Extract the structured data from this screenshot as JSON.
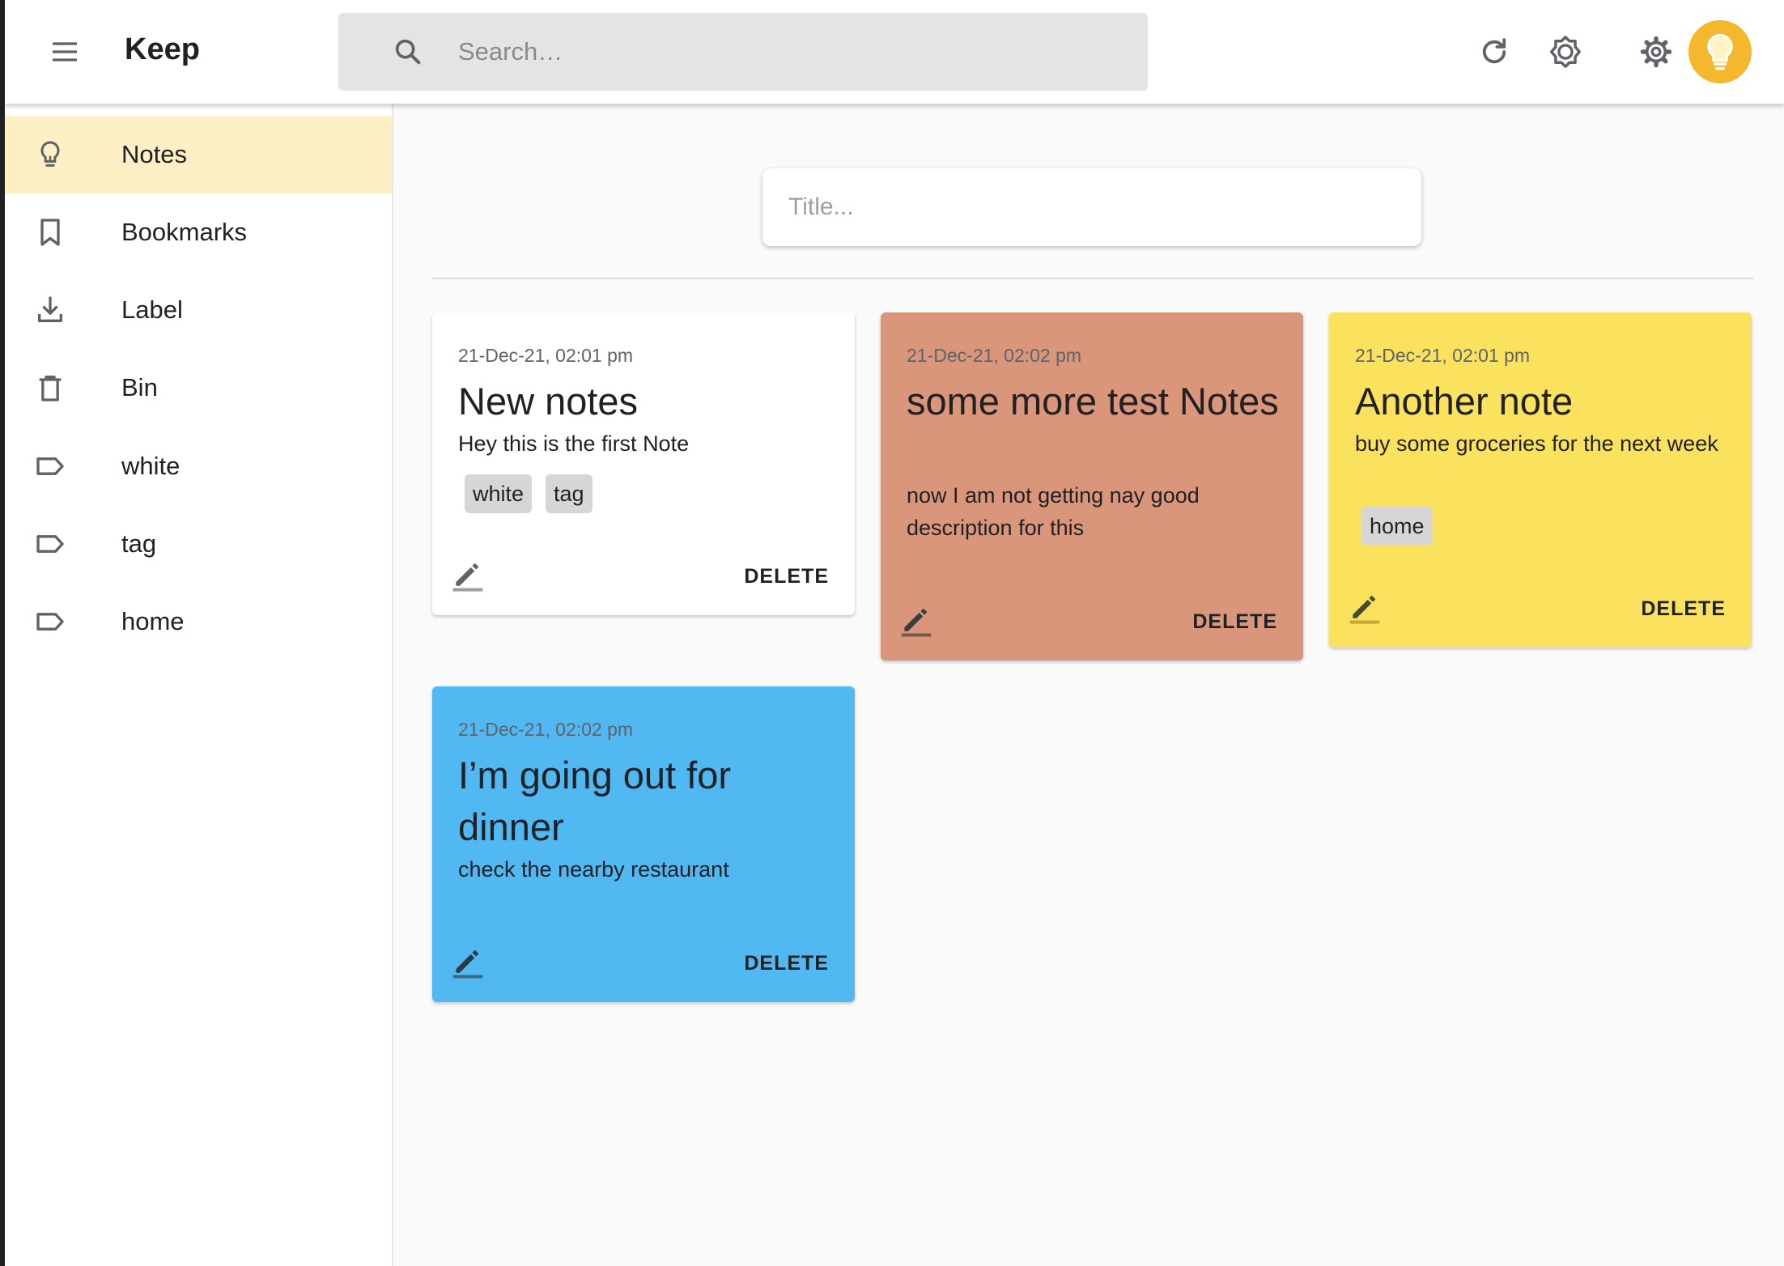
{
  "header": {
    "app_title": "Keep",
    "search_placeholder": "Search…",
    "icons": [
      "menu-icon",
      "search-icon",
      "refresh-icon",
      "brightness-icon",
      "settings-icon",
      "lightbulb-avatar"
    ]
  },
  "sidebar": {
    "items": [
      {
        "label": "Notes",
        "icon": "lightbulb-icon",
        "active": true
      },
      {
        "label": "Bookmarks",
        "icon": "bookmark-icon"
      },
      {
        "label": "Label",
        "icon": "download-icon"
      },
      {
        "label": "Bin",
        "icon": "trash-icon"
      },
      {
        "label": "white",
        "icon": "label-icon"
      },
      {
        "label": "tag",
        "icon": "label-icon"
      },
      {
        "label": "home",
        "icon": "label-icon"
      }
    ]
  },
  "composer": {
    "title_placeholder": "Title..."
  },
  "notes": [
    {
      "date": "21-Dec-21, 02:01 pm",
      "title": "New notes",
      "description": "Hey this is the first Note",
      "tags": [
        "white",
        "tag"
      ],
      "color": "#ffffff",
      "delete_label": "DELETE"
    },
    {
      "date": "21-Dec-21, 02:02 pm",
      "title": "some more test Notes",
      "description": "now I am not getting nay good description for this",
      "tags": [],
      "color": "#d9967b",
      "delete_label": "DELETE"
    },
    {
      "date": "21-Dec-21, 02:01 pm",
      "title": "Another note",
      "description": "buy some groceries for the next week",
      "tags": [
        "home"
      ],
      "color": "#fbe25e",
      "delete_label": "DELETE"
    },
    {
      "date": "21-Dec-21, 02:02 pm",
      "title": "I’m going out for dinner",
      "description": "check the nearby restaurant",
      "tags": [],
      "color": "#52b8f2",
      "delete_label": "DELETE"
    }
  ],
  "colors": {
    "active_nav": "#fdf0c4",
    "avatar": "#f5b72e",
    "background": "#fafafa"
  }
}
